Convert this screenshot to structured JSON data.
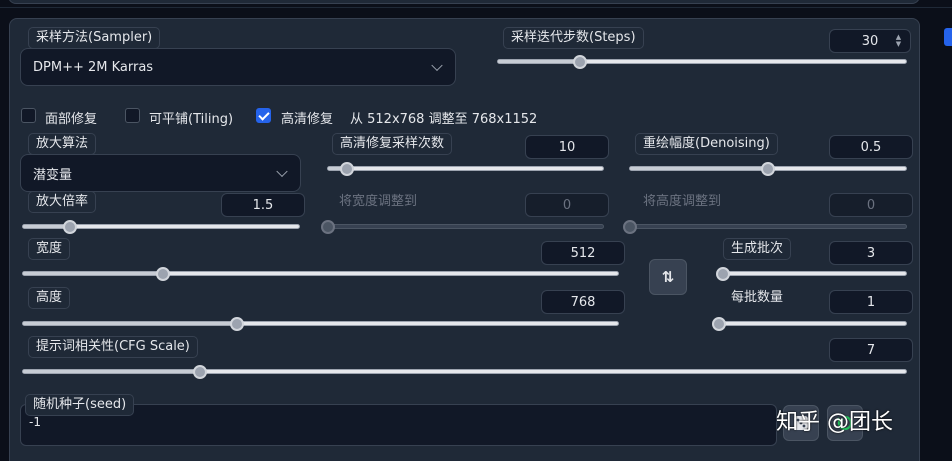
{
  "sampler": {
    "label": "采样方法(Sampler)",
    "value": "DPM++ 2M Karras"
  },
  "steps": {
    "label": "采样迭代步数(Steps)",
    "value": "30",
    "fraction": 0.2
  },
  "checkboxes": {
    "restore_faces": {
      "label": "面部修复",
      "checked": false
    },
    "tiling": {
      "label": "可平铺(Tiling)",
      "checked": false
    },
    "hires_fix": {
      "label": "高清修复",
      "checked": true,
      "info": "从 512x768 调整至 768x1152"
    }
  },
  "upscaler": {
    "label": "放大算法",
    "value": "潜变量"
  },
  "hires_steps": {
    "label": "高清修复采样次数",
    "value": "10",
    "fraction": 0.07
  },
  "denoising": {
    "label": "重绘幅度(Denoising)",
    "value": "0.5",
    "fraction": 0.5
  },
  "upscale_by": {
    "label": "放大倍率",
    "value": "1.5",
    "fraction": 0.17
  },
  "resize_width": {
    "label": "将宽度调整到",
    "value": "0",
    "fraction": 0.0
  },
  "resize_height": {
    "label": "将高度调整到",
    "value": "0",
    "fraction": 0.0
  },
  "width": {
    "label": "宽度",
    "value": "512",
    "fraction": 0.235
  },
  "height": {
    "label": "高度",
    "value": "768",
    "fraction": 0.36
  },
  "batch_count": {
    "label": "生成批次",
    "value": "3",
    "fraction": 0.02
  },
  "batch_size": {
    "label": "每批数量",
    "value": "1",
    "fraction": 0.0
  },
  "cfg": {
    "label": "提示词相关性(CFG Scale)",
    "value": "7",
    "fraction": 0.2
  },
  "swap": {
    "icon": "swap-arrows-icon",
    "symbol": "⇅"
  },
  "seed": {
    "label": "随机种子(seed)",
    "value": "-1"
  },
  "watermark": "知乎 @团长"
}
